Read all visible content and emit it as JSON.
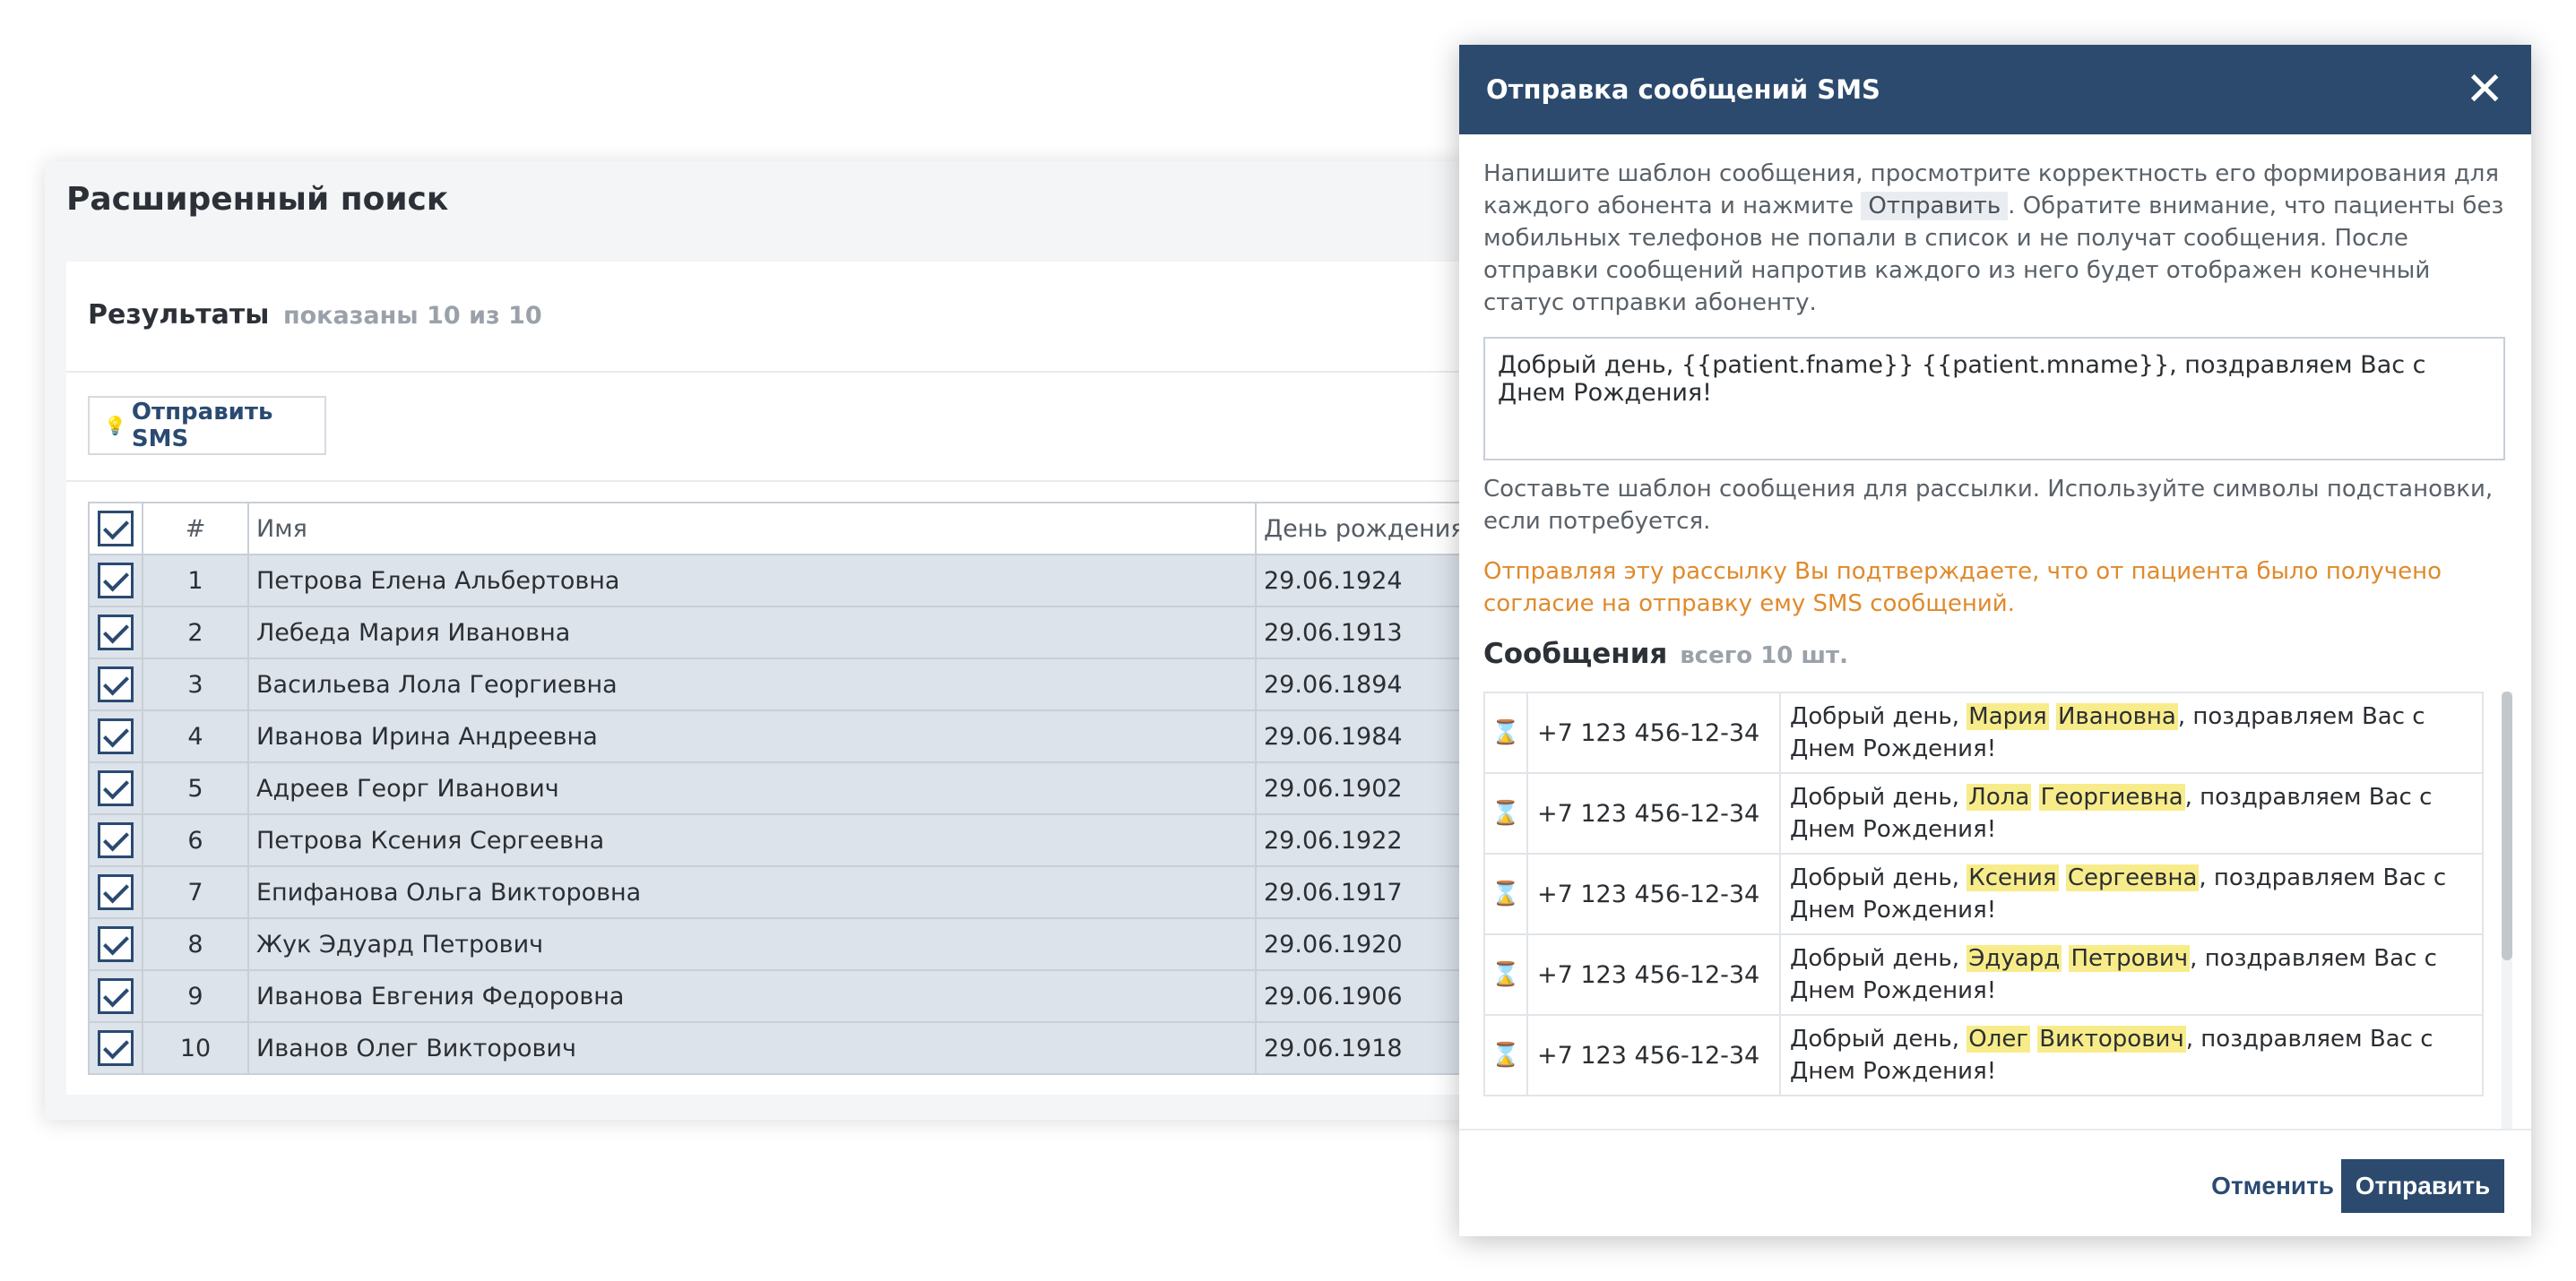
{
  "search": {
    "title": "Расширенный поиск",
    "results_title": "Результаты",
    "results_summary": "показаны 10 из 10",
    "send_sms_label": "Отправить SMS",
    "columns": [
      "#",
      "Имя",
      "День рождения"
    ],
    "rows": [
      {
        "n": "1",
        "name": "Петрова Елена Альбертовна",
        "bday": "29.06.1924"
      },
      {
        "n": "2",
        "name": "Лебеда Мария Ивановна",
        "bday": "29.06.1913"
      },
      {
        "n": "3",
        "name": "Васильева Лола Георгиевна",
        "bday": "29.06.1894"
      },
      {
        "n": "4",
        "name": "Иванова Ирина Андреевна",
        "bday": "29.06.1984"
      },
      {
        "n": "5",
        "name": "Адреев Георг Иванович",
        "bday": "29.06.1902"
      },
      {
        "n": "6",
        "name": "Петрова Ксения Сергеевна",
        "bday": "29.06.1922"
      },
      {
        "n": "7",
        "name": "Епифанова Ольга Викторовна",
        "bday": "29.06.1917"
      },
      {
        "n": "8",
        "name": "Жук Эдуард Петрович",
        "bday": "29.06.1920"
      },
      {
        "n": "9",
        "name": "Иванова Евгения Федоровна",
        "bday": "29.06.1906"
      },
      {
        "n": "10",
        "name": "Иванов Олег Викторович",
        "bday": "29.06.1918"
      }
    ]
  },
  "modal": {
    "title": "Отправка сообщений SMS",
    "intro_before": "Напишите шаблон сообщения, просмотрите корректность его формирования для каждого абонента и нажмите",
    "intro_kbd": "Отправить",
    "intro_after": ". Обратите внимание, что пациенты без мобильных телефонов не попали в список и не получат сообщения. После отправки сообщений напротив каждого из него будет отображен конечный статус отправки абоненту.",
    "template_value": "Добрый день, {{patient.fname}} {{patient.mname}}, поздравляем Вас с Днем Рождения!",
    "hint": "Составьте шаблон сообщения для рассылки. Используйте символы подстановки, если потребуется.",
    "warning": "Отправляя эту рассылку Вы подтверждаете, что от пациента было получено согласие на отправку ему SMS сообщений.",
    "messages_title": "Сообщения",
    "messages_count": "всего 10 шт.",
    "msg_prefix": "Добрый день, ",
    "msg_suffix": ", поздравляем Вас с Днем Рождения!",
    "status_icon": "hourglass-icon",
    "messages": [
      {
        "phone": "+7 123 456-12-34",
        "fname": "Мария",
        "mname": "Ивановна"
      },
      {
        "phone": "+7 123 456-12-34",
        "fname": "Лола",
        "mname": "Георгиевна"
      },
      {
        "phone": "+7 123 456-12-34",
        "fname": "Ксения",
        "mname": "Сергеевна"
      },
      {
        "phone": "+7 123 456-12-34",
        "fname": "Эдуард",
        "mname": "Петрович"
      },
      {
        "phone": "+7 123 456-12-34",
        "fname": "Олег",
        "mname": "Викторович"
      }
    ],
    "cancel_label": "Отменить",
    "send_label": "Отправить"
  },
  "colors": {
    "header": "#2c4a6e",
    "accent": "#2a4a72",
    "warning": "#e08a2c",
    "row_selected": "#dde3eb",
    "highlight": "#f8ec8a"
  }
}
